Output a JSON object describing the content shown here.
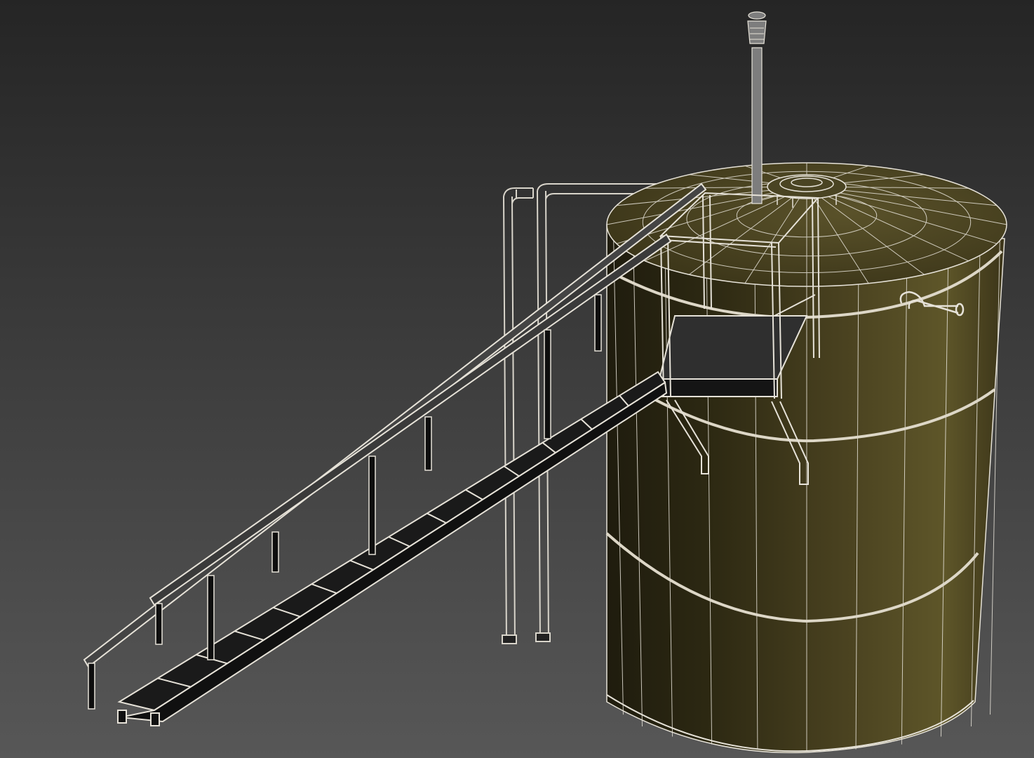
{
  "viewport": {
    "shading": "wireframe-on-shaded",
    "background": {
      "top": "#262626",
      "bottom": "#565656"
    },
    "wire_color": "#e6e2d8",
    "tank_color": {
      "shade_dark": "#23200f",
      "shade_mid": "#4a4220",
      "shade_light": "#6f6634",
      "roof": "#514a23"
    }
  },
  "scene": {
    "objects": [
      {
        "name": "storage-tank",
        "icon": "cylinder-tank"
      },
      {
        "name": "vent-pipe",
        "icon": "vertical-pipe"
      },
      {
        "name": "top-hatch",
        "icon": "flange"
      },
      {
        "name": "side-nozzle",
        "icon": "elbow-pipe"
      },
      {
        "name": "platform",
        "icon": "landing-platform"
      },
      {
        "name": "stair-stringers",
        "icon": "inclined-ladder"
      },
      {
        "name": "handrail",
        "icon": "guard-rail"
      },
      {
        "name": "pipe-supports",
        "icon": "pipe-legs"
      }
    ]
  }
}
